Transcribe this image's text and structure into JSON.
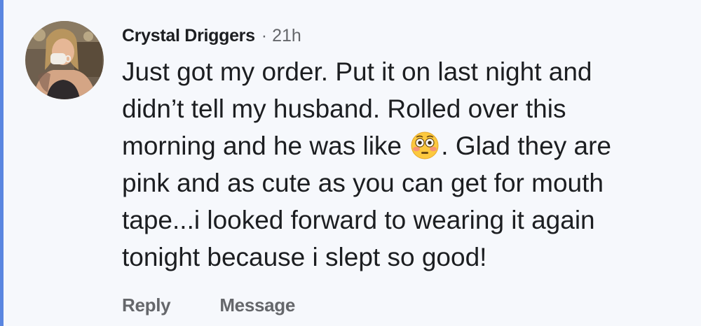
{
  "comment": {
    "author": "Crystal Driggers",
    "separator": "·",
    "time": "21h",
    "avatar_icon": "user-photo-avatar",
    "body_lines": [
      "Just got my order. Put it on last night and",
      "didn’t tell my husband. Rolled over this",
      "morning and he was like",
      ". Glad they are",
      "pink and as cute as you can get for mouth",
      "tape...i looked forward to wearing it again",
      "tonight because i slept so good!"
    ],
    "emoji_icon": "flushed-face-emoji",
    "actions": {
      "reply": "Reply",
      "message": "Message"
    }
  },
  "colors": {
    "background": "#f6f8fc",
    "accent_bar": "#5a86e0",
    "text_primary": "#1c1e21",
    "text_secondary": "#65676b"
  }
}
